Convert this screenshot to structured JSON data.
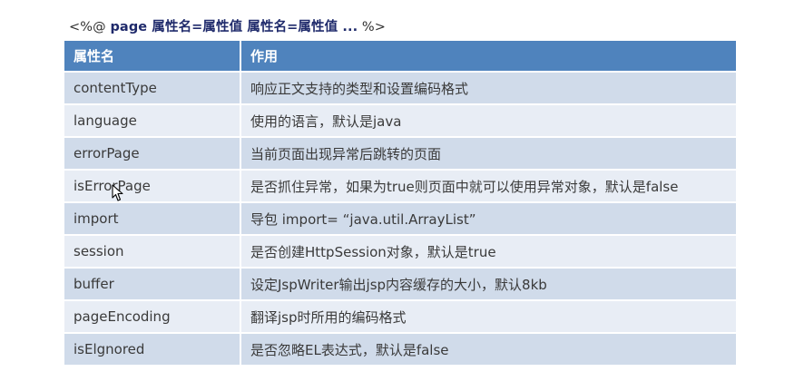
{
  "syntax_line": {
    "open": "<%@",
    "keyword": "page 属性名=属性值 属性名=属性值 ...",
    "close": "%>"
  },
  "table": {
    "headers": {
      "name": "属性名",
      "purpose": "作用"
    },
    "rows": [
      {
        "name": "contentType",
        "purpose": "响应正文支持的类型和设置编码格式"
      },
      {
        "name": "language",
        "purpose": "使用的语言，默认是java"
      },
      {
        "name": "errorPage",
        "purpose": "当前页面出现异常后跳转的页面"
      },
      {
        "name": "isErrorPage",
        "purpose": "是否抓住异常，如果为true则页面中就可以使用异常对象，默认是false"
      },
      {
        "name": "import",
        "purpose": "导包 import= “java.util.ArrayList”"
      },
      {
        "name": "session",
        "purpose": "是否创建HttpSession对象，默认是true"
      },
      {
        "name": "buffer",
        "purpose": "设定JspWriter输出jsp内容缓存的大小，默认8kb"
      },
      {
        "name": "pageEncoding",
        "purpose": "翻译jsp时所用的编码格式"
      },
      {
        "name": "isElgnored",
        "purpose": "是否忽略EL表达式，默认是false"
      }
    ]
  },
  "colors": {
    "header_bg": "#4f83bd",
    "row_odd_bg": "#d0dbea",
    "row_even_bg": "#e8edf5"
  }
}
